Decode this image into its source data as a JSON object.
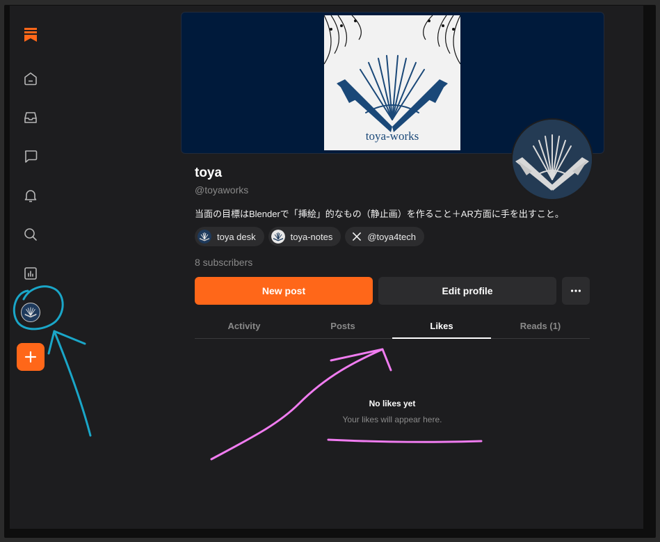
{
  "profile": {
    "name": "toya",
    "handle": "@toyaworks",
    "bio": "当面の目標はBlenderで「挿絵」的なもの（静止画）を作ること＋AR方面に手を出すこと。",
    "subscribers": "8 subscribers",
    "banner_text": "toya-works"
  },
  "links": [
    {
      "label": "toya desk",
      "icon": "fan-logo-icon"
    },
    {
      "label": "toya-notes",
      "icon": "fan-logo-icon"
    },
    {
      "label": "@toya4tech",
      "icon": "x-logo-icon"
    }
  ],
  "actions": {
    "new_post": "New post",
    "edit_profile": "Edit profile"
  },
  "tabs": [
    {
      "label": "Activity",
      "active": false
    },
    {
      "label": "Posts",
      "active": false
    },
    {
      "label": "Likes",
      "active": true
    },
    {
      "label": "Reads (1)",
      "active": false
    }
  ],
  "empty_state": {
    "title": "No likes yet",
    "subtitle": "Your likes will appear here."
  },
  "colors": {
    "accent": "#ff6719",
    "background": "#1d1d1f",
    "banner": "#001a3b",
    "annotation_cyan": "#1aa6c8",
    "annotation_pink": "#f07cf0"
  }
}
